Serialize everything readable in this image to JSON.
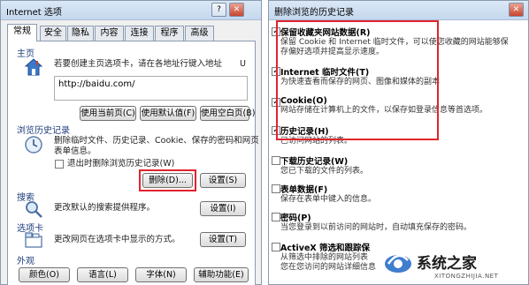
{
  "left_window": {
    "title": "Internet 选项",
    "tabs": [
      {
        "label": "常规"
      },
      {
        "label": "安全"
      },
      {
        "label": "隐私"
      },
      {
        "label": "内容"
      },
      {
        "label": "连接"
      },
      {
        "label": "程序"
      },
      {
        "label": "高级"
      }
    ],
    "homepage": {
      "header": "主页",
      "description": "若要创建主页选项卡，请在各地址行键入地址",
      "description_suffix": "U",
      "url_value": "http://baidu.com/",
      "buttons": [
        "使用当前页(C)",
        "使用默认值(F)",
        "使用空白页(B)"
      ]
    },
    "history": {
      "header": "浏览历史记录",
      "description_lines": [
        "删除临时文件、历史记录、Cookie、保存的密码和网页",
        "表单信息。"
      ],
      "checkbox_label": "退出时删除浏览历史记录(W)",
      "checkbox_checked": false,
      "delete_button": "删除(D)...",
      "settings_button": "设置(S)"
    },
    "search": {
      "header": "搜索",
      "description": "更改默认的搜索提供程序。",
      "settings_button": "设置(I)"
    },
    "tabs_section": {
      "header": "选项卡",
      "description": "更改网页在选项卡中显示的方式。",
      "settings_button": "设置(T)"
    },
    "appearance": {
      "header": "外观",
      "buttons": [
        "颜色(O)",
        "语言(L)",
        "字体(N)",
        "辅助功能(E)"
      ]
    }
  },
  "right_window": {
    "title": "删除浏览的历史记录",
    "items": [
      {
        "title": "保留收藏夹网站数据(R)",
        "lines": [
          "保留 Cookie 和 Internet 临时文件，可以使您收藏的网站能够保",
          "存偏好选项并提高显示速度。"
        ],
        "checked": true
      },
      {
        "title": "Internet 临时文件(T)",
        "lines": [
          "为快速查看而保存的网页、图像和媒体的副本"
        ],
        "checked": true
      },
      {
        "title": "Cookie(O)",
        "lines": [
          "网站存储在计算机上的文件，以保存如登录信息等首选项。"
        ],
        "checked": true
      },
      {
        "title": "历史记录(H)",
        "lines": [
          "已访问网站的列表。"
        ],
        "checked": true
      },
      {
        "title": "下载历史记录(W)",
        "lines": [
          "您已下载的文件的列表。"
        ],
        "checked": false
      },
      {
        "title": "表单数据(F)",
        "lines": [
          "保存在表单中键入的信息。"
        ],
        "checked": false
      },
      {
        "title": "密码(P)",
        "lines": [
          "当您登录到以前访问的网站时，自动填充保存的密码。"
        ],
        "checked": false
      },
      {
        "title": "ActiveX 筛选和跟踪保",
        "lines": [
          "从筛选中排除的网站列表",
          "您在您访问的网站详细信息"
        ],
        "checked": false
      }
    ]
  },
  "watermark": {
    "text": "系统之家",
    "url": "XITONGZHIJIA.NET"
  },
  "colors": {
    "highlight_red": "#e0242f",
    "title_gradient_top": "#dbe8f6",
    "section_header_blue": "#1e3d7b"
  }
}
